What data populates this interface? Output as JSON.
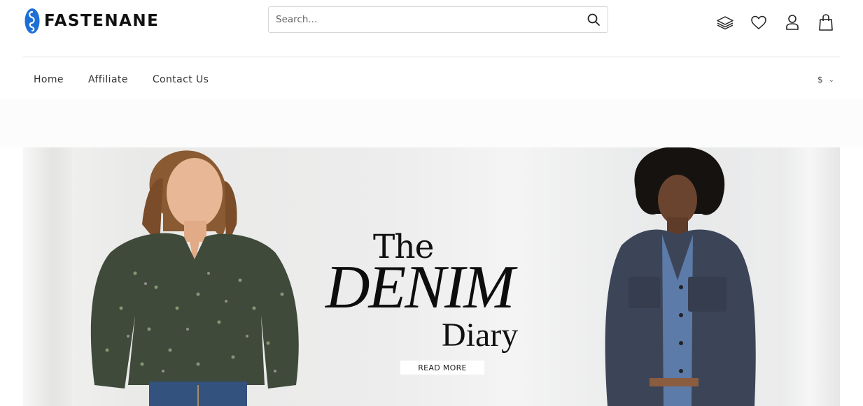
{
  "brand": {
    "name": "FASTENANE",
    "accent": "#1d6fd6"
  },
  "search": {
    "placeholder": "Search..."
  },
  "header_icons": [
    "layers-icon",
    "heart-icon",
    "user-icon",
    "bag-icon"
  ],
  "nav": {
    "items": [
      "Home",
      "Affiliate",
      "Contact Us"
    ]
  },
  "currency": {
    "label": "$"
  },
  "hero": {
    "line1": "The",
    "line2": "DENIM",
    "line3": "Diary",
    "cta": "READ MORE"
  }
}
